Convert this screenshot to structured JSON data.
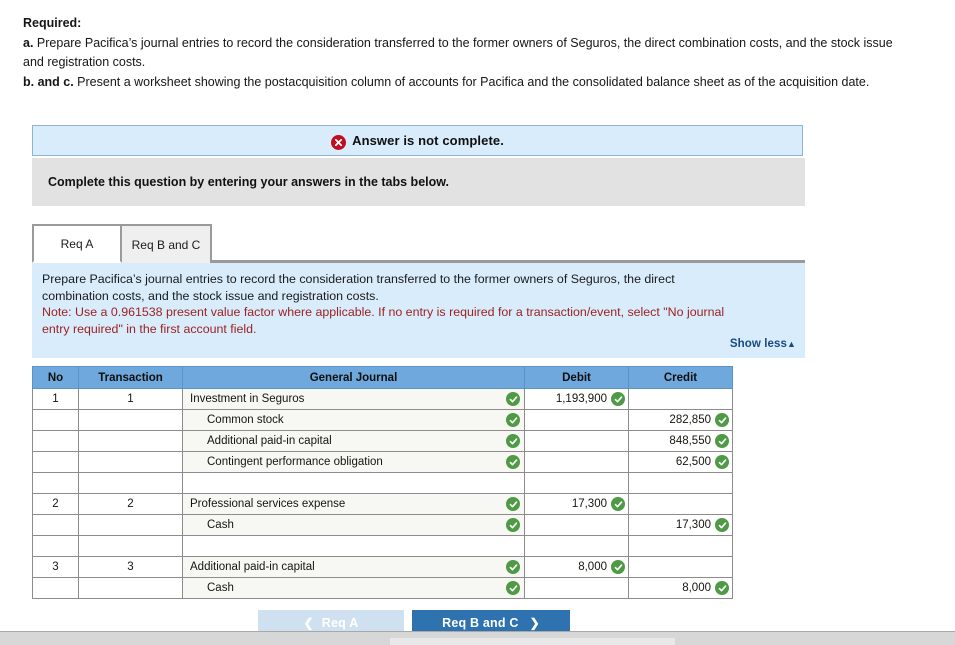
{
  "required": {
    "heading": "Required:",
    "item_a_label": "a.",
    "item_a_text": " Prepare Pacifica’s journal entries to record the consideration transferred to the former owners of Seguros, the direct combination costs, and the stock issue and registration costs.",
    "item_bc_label": "b. and c.",
    "item_bc_text": " Present a worksheet showing the postacquisition column of accounts for Pacifica and the consolidated balance sheet as of the acquisition date."
  },
  "banner": {
    "icon": "error-x-icon",
    "text": "Answer is not complete.",
    "bg_color": "#d9ecfb",
    "icon_color": "#c20c20"
  },
  "complete_bar": {
    "text": "Complete this question by entering your answers in the tabs below."
  },
  "tabs": [
    {
      "label": "Req A",
      "active": true
    },
    {
      "label": "Req B and C",
      "active": false
    }
  ],
  "instructions": {
    "line1": "Prepare Pacifica’s journal entries to record the consideration transferred to the former owners of Seguros, the direct",
    "line2": "combination costs, and the stock issue and registration costs.",
    "note1": "Note: Use a 0.961538 present value factor where applicable. If no entry is required for a transaction/event, select \"No journal",
    "note2": "entry required\" in the first account field.",
    "show_less": "Show less",
    "show_less_caret": "▲"
  },
  "table": {
    "headers": [
      "No",
      "Transaction",
      "General Journal",
      "Debit",
      "Credit"
    ],
    "rows": [
      {
        "no": "1",
        "transaction": "1",
        "account": "Investment in Seguros",
        "indent": false,
        "blank": false,
        "debit": "1,193,900",
        "credit": "",
        "account_check": true,
        "debit_check": true,
        "credit_check": false
      },
      {
        "no": "",
        "transaction": "",
        "account": "Common stock",
        "indent": true,
        "blank": false,
        "debit": "",
        "credit": "282,850",
        "account_check": true,
        "debit_check": false,
        "credit_check": true
      },
      {
        "no": "",
        "transaction": "",
        "account": "Additional paid-in capital",
        "indent": true,
        "blank": false,
        "debit": "",
        "credit": "848,550",
        "account_check": true,
        "debit_check": false,
        "credit_check": true
      },
      {
        "no": "",
        "transaction": "",
        "account": "Contingent performance obligation",
        "indent": true,
        "blank": false,
        "debit": "",
        "credit": "62,500",
        "account_check": true,
        "debit_check": false,
        "credit_check": true
      },
      {
        "no": "",
        "transaction": "",
        "account": "",
        "indent": false,
        "blank": true,
        "debit": "",
        "credit": "",
        "account_check": false,
        "debit_check": false,
        "credit_check": false
      },
      {
        "no": "2",
        "transaction": "2",
        "account": "Professional services expense",
        "indent": false,
        "blank": false,
        "debit": "17,300",
        "credit": "",
        "account_check": true,
        "debit_check": true,
        "credit_check": false
      },
      {
        "no": "",
        "transaction": "",
        "account": "Cash",
        "indent": true,
        "blank": false,
        "debit": "",
        "credit": "17,300",
        "account_check": true,
        "debit_check": false,
        "credit_check": true
      },
      {
        "no": "",
        "transaction": "",
        "account": "",
        "indent": false,
        "blank": true,
        "debit": "",
        "credit": "",
        "account_check": false,
        "debit_check": false,
        "credit_check": false
      },
      {
        "no": "3",
        "transaction": "3",
        "account": "Additional paid-in capital",
        "indent": false,
        "blank": false,
        "debit": "8,000",
        "credit": "",
        "account_check": true,
        "debit_check": true,
        "credit_check": false
      },
      {
        "no": "",
        "transaction": "",
        "account": "Cash",
        "indent": true,
        "blank": false,
        "debit": "",
        "credit": "8,000",
        "account_check": true,
        "debit_check": false,
        "credit_check": true
      }
    ],
    "header_bg": "#6fa8dc",
    "check_color": "#4e9a45"
  },
  "nav": {
    "prev_label": "Req A",
    "prev_arrow": "❮",
    "next_label": "Req B and C",
    "next_arrow": "❯",
    "next_bg": "#2e72b0",
    "prev_bg": "#cfe0f0"
  }
}
